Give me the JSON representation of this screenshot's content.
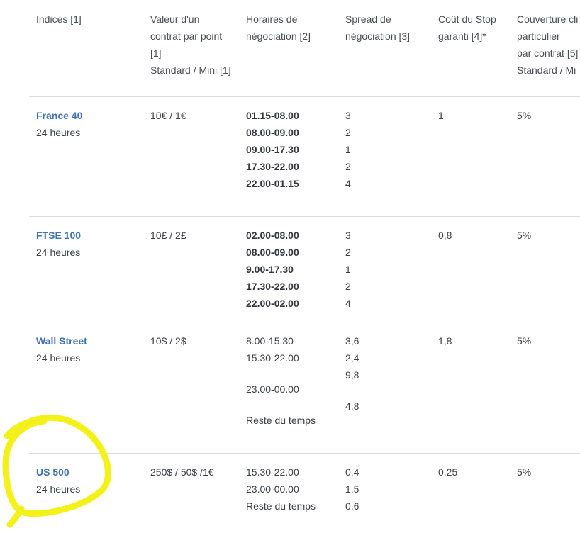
{
  "headers": {
    "indices": [
      "Indices [1]"
    ],
    "valeur": [
      "Valeur d'un",
      "contrat par point",
      "[1]",
      "Standard / Mini [1]"
    ],
    "horaires": [
      "Horaires de",
      "négociation [2]"
    ],
    "spread": [
      "Spread de",
      "négociation [3]"
    ],
    "cout": [
      "Coût du Stop",
      "garanti [4]*"
    ],
    "couverture": [
      "Couverture cli",
      "particulier",
      "par contrat [5]",
      "Standard / Mi"
    ]
  },
  "rows": [
    {
      "name": "France 40",
      "hours": "24 heures",
      "value": "10€ / 1€",
      "schedule": [
        "01.15-08.00",
        "08.00-09.00",
        "09.00-17.30",
        "17.30-22.00",
        "22.00-01.15"
      ],
      "spreads": [
        "3",
        "2",
        "1",
        "2",
        "4"
      ],
      "stop": "1",
      "cover": "5%"
    },
    {
      "name": "FTSE 100",
      "hours": "24 heures",
      "value": "10£ / 2£",
      "schedule": [
        "02.00-08.00",
        "08.00-09.00",
        "9.00-17.30",
        "17.30-22.00",
        "22.00-02.00"
      ],
      "spreads": [
        "3",
        "2",
        "1",
        "2",
        "4"
      ],
      "stop": "0,8",
      "cover": "5%"
    },
    {
      "name": "Wall Street",
      "hours": "24 heures",
      "value": "10$ / 2$",
      "schedule": [
        "8.00-15.30",
        "15.30-22.00",
        "",
        "23.00-00.00",
        "",
        "Reste du temps"
      ],
      "spreads": [
        "3,6",
        "2,4",
        "9,8",
        "",
        "4,8"
      ],
      "stop": "1,8",
      "cover": "5%"
    },
    {
      "name": "US 500",
      "hours": "24 heures",
      "value": "250$ / 50$ /1€",
      "schedule": [
        "15.30-22.00",
        "23.00-00.00",
        "Reste du temps"
      ],
      "spreads": [
        "0,4",
        "1,5",
        "0,6"
      ],
      "stop": "0,25",
      "cover": "5%"
    }
  ],
  "annotation_color": "#f4f11a"
}
